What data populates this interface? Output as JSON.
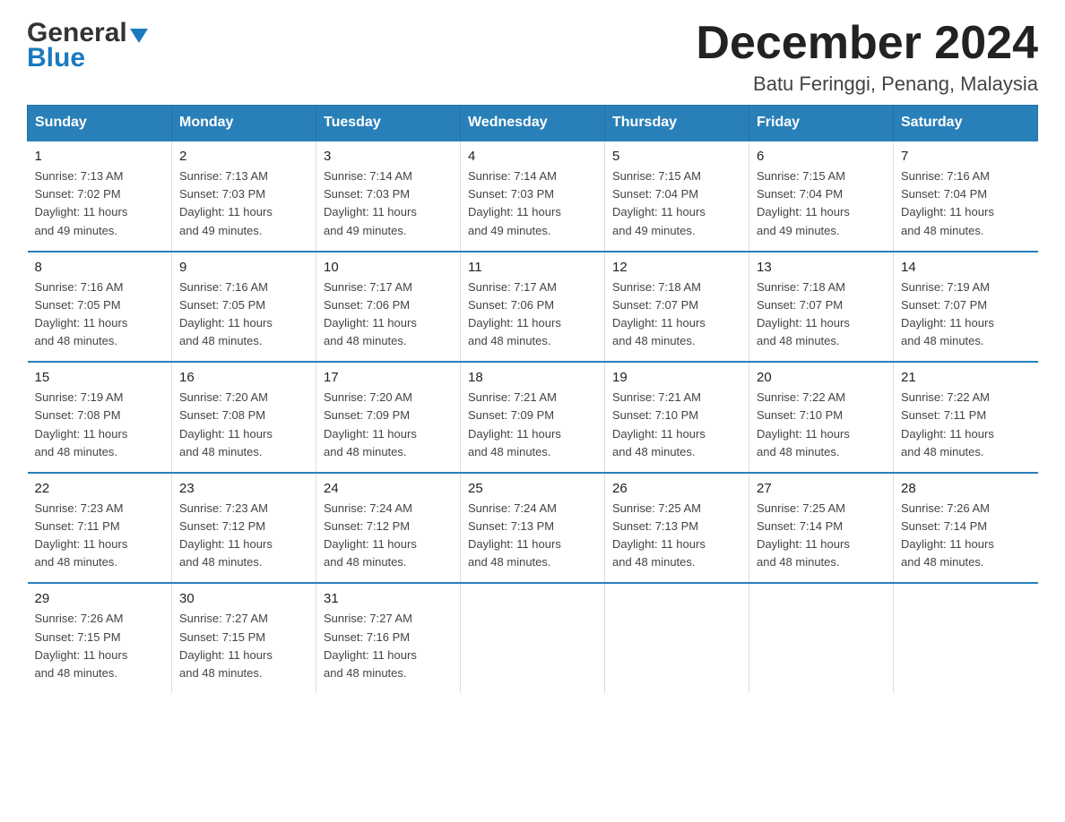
{
  "logo": {
    "general": "General",
    "blue": "Blue",
    "triangle": "▼"
  },
  "title": "December 2024",
  "subtitle": "Batu Feringgi, Penang, Malaysia",
  "headers": [
    "Sunday",
    "Monday",
    "Tuesday",
    "Wednesday",
    "Thursday",
    "Friday",
    "Saturday"
  ],
  "weeks": [
    [
      {
        "day": "1",
        "info": "Sunrise: 7:13 AM\nSunset: 7:02 PM\nDaylight: 11 hours\nand 49 minutes."
      },
      {
        "day": "2",
        "info": "Sunrise: 7:13 AM\nSunset: 7:03 PM\nDaylight: 11 hours\nand 49 minutes."
      },
      {
        "day": "3",
        "info": "Sunrise: 7:14 AM\nSunset: 7:03 PM\nDaylight: 11 hours\nand 49 minutes."
      },
      {
        "day": "4",
        "info": "Sunrise: 7:14 AM\nSunset: 7:03 PM\nDaylight: 11 hours\nand 49 minutes."
      },
      {
        "day": "5",
        "info": "Sunrise: 7:15 AM\nSunset: 7:04 PM\nDaylight: 11 hours\nand 49 minutes."
      },
      {
        "day": "6",
        "info": "Sunrise: 7:15 AM\nSunset: 7:04 PM\nDaylight: 11 hours\nand 49 minutes."
      },
      {
        "day": "7",
        "info": "Sunrise: 7:16 AM\nSunset: 7:04 PM\nDaylight: 11 hours\nand 48 minutes."
      }
    ],
    [
      {
        "day": "8",
        "info": "Sunrise: 7:16 AM\nSunset: 7:05 PM\nDaylight: 11 hours\nand 48 minutes."
      },
      {
        "day": "9",
        "info": "Sunrise: 7:16 AM\nSunset: 7:05 PM\nDaylight: 11 hours\nand 48 minutes."
      },
      {
        "day": "10",
        "info": "Sunrise: 7:17 AM\nSunset: 7:06 PM\nDaylight: 11 hours\nand 48 minutes."
      },
      {
        "day": "11",
        "info": "Sunrise: 7:17 AM\nSunset: 7:06 PM\nDaylight: 11 hours\nand 48 minutes."
      },
      {
        "day": "12",
        "info": "Sunrise: 7:18 AM\nSunset: 7:07 PM\nDaylight: 11 hours\nand 48 minutes."
      },
      {
        "day": "13",
        "info": "Sunrise: 7:18 AM\nSunset: 7:07 PM\nDaylight: 11 hours\nand 48 minutes."
      },
      {
        "day": "14",
        "info": "Sunrise: 7:19 AM\nSunset: 7:07 PM\nDaylight: 11 hours\nand 48 minutes."
      }
    ],
    [
      {
        "day": "15",
        "info": "Sunrise: 7:19 AM\nSunset: 7:08 PM\nDaylight: 11 hours\nand 48 minutes."
      },
      {
        "day": "16",
        "info": "Sunrise: 7:20 AM\nSunset: 7:08 PM\nDaylight: 11 hours\nand 48 minutes."
      },
      {
        "day": "17",
        "info": "Sunrise: 7:20 AM\nSunset: 7:09 PM\nDaylight: 11 hours\nand 48 minutes."
      },
      {
        "day": "18",
        "info": "Sunrise: 7:21 AM\nSunset: 7:09 PM\nDaylight: 11 hours\nand 48 minutes."
      },
      {
        "day": "19",
        "info": "Sunrise: 7:21 AM\nSunset: 7:10 PM\nDaylight: 11 hours\nand 48 minutes."
      },
      {
        "day": "20",
        "info": "Sunrise: 7:22 AM\nSunset: 7:10 PM\nDaylight: 11 hours\nand 48 minutes."
      },
      {
        "day": "21",
        "info": "Sunrise: 7:22 AM\nSunset: 7:11 PM\nDaylight: 11 hours\nand 48 minutes."
      }
    ],
    [
      {
        "day": "22",
        "info": "Sunrise: 7:23 AM\nSunset: 7:11 PM\nDaylight: 11 hours\nand 48 minutes."
      },
      {
        "day": "23",
        "info": "Sunrise: 7:23 AM\nSunset: 7:12 PM\nDaylight: 11 hours\nand 48 minutes."
      },
      {
        "day": "24",
        "info": "Sunrise: 7:24 AM\nSunset: 7:12 PM\nDaylight: 11 hours\nand 48 minutes."
      },
      {
        "day": "25",
        "info": "Sunrise: 7:24 AM\nSunset: 7:13 PM\nDaylight: 11 hours\nand 48 minutes."
      },
      {
        "day": "26",
        "info": "Sunrise: 7:25 AM\nSunset: 7:13 PM\nDaylight: 11 hours\nand 48 minutes."
      },
      {
        "day": "27",
        "info": "Sunrise: 7:25 AM\nSunset: 7:14 PM\nDaylight: 11 hours\nand 48 minutes."
      },
      {
        "day": "28",
        "info": "Sunrise: 7:26 AM\nSunset: 7:14 PM\nDaylight: 11 hours\nand 48 minutes."
      }
    ],
    [
      {
        "day": "29",
        "info": "Sunrise: 7:26 AM\nSunset: 7:15 PM\nDaylight: 11 hours\nand 48 minutes."
      },
      {
        "day": "30",
        "info": "Sunrise: 7:27 AM\nSunset: 7:15 PM\nDaylight: 11 hours\nand 48 minutes."
      },
      {
        "day": "31",
        "info": "Sunrise: 7:27 AM\nSunset: 7:16 PM\nDaylight: 11 hours\nand 48 minutes."
      },
      null,
      null,
      null,
      null
    ]
  ]
}
